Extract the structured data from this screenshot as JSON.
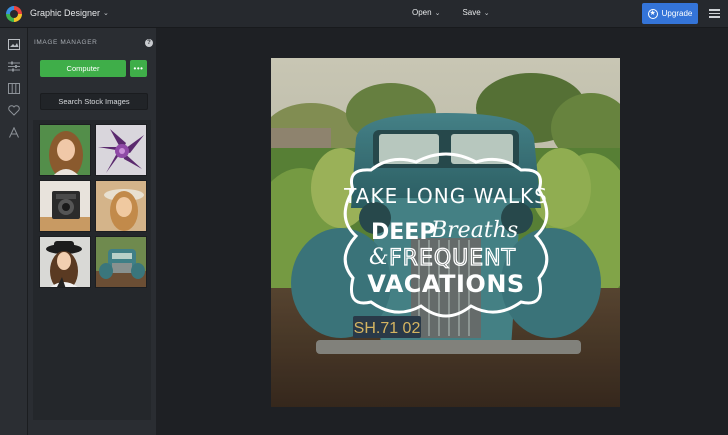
{
  "topbar": {
    "app_title": "Graphic Designer",
    "open_label": "Open",
    "save_label": "Save",
    "upgrade_label": "Upgrade"
  },
  "rail": {
    "icons": [
      "image-manager-icon",
      "adjust-icon",
      "layout-icon",
      "favorites-icon",
      "text-icon"
    ]
  },
  "panel": {
    "title": "IMAGE MANAGER",
    "help": "?",
    "computer_label": "Computer",
    "more_label": "•••",
    "stock_label": "Search Stock Images",
    "thumbnails": [
      {
        "name": "thumb-woman-smiling"
      },
      {
        "name": "thumb-purple-flower"
      },
      {
        "name": "thumb-vintage-camera"
      },
      {
        "name": "thumb-woman-hat"
      },
      {
        "name": "thumb-woman-black-hat"
      },
      {
        "name": "thumb-vintage-truck"
      }
    ]
  },
  "canvas": {
    "quote_line1": "TAKE LONG WALKS",
    "quote_line2a": "DEEP",
    "quote_line2b": "Breaths",
    "quote_line3a": "&",
    "quote_line3b": "FREQUENT",
    "quote_line4": "VACATIONS",
    "plate": "SH.71 02"
  },
  "colors": {
    "topbar_bg": "#26292e",
    "upgrade_blue": "#3474d8",
    "computer_green": "#3fae49",
    "panel_bg": "#2a2d32",
    "workspace_bg": "#1e2024"
  }
}
